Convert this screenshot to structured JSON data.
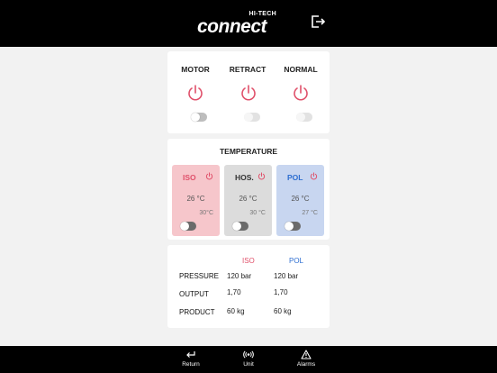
{
  "brand": {
    "tagline": "HI-TECH",
    "name": "connect"
  },
  "controls": [
    {
      "label": "MOTOR",
      "icon": "power-icon",
      "toggle_on": false
    },
    {
      "label": "RETRACT",
      "icon": "power-icon",
      "toggle_on": false
    },
    {
      "label": "NORMAL",
      "icon": "power-icon",
      "toggle_on": false
    }
  ],
  "temperature": {
    "title": "TEMPERATURE",
    "zones": [
      {
        "name": "ISO",
        "current": "26 °C",
        "setpoint": "30°C",
        "toggle_on": false
      },
      {
        "name": "HOS.",
        "current": "26 °C",
        "setpoint": "30 °C",
        "toggle_on": false
      },
      {
        "name": "POL",
        "current": "26 °C",
        "setpoint": "27 °C",
        "toggle_on": false
      }
    ]
  },
  "readings": {
    "columns": [
      "ISO",
      "POL"
    ],
    "rows": [
      {
        "label": "PRESSURE",
        "iso": "120 bar",
        "pol": "120 bar"
      },
      {
        "label": "OUTPUT",
        "iso": "1,70",
        "pol": "1,70"
      },
      {
        "label": "PRODUCT",
        "iso": "60 kg",
        "pol": "60 kg"
      }
    ]
  },
  "nav": [
    {
      "label": "Return",
      "icon": "return-icon"
    },
    {
      "label": "Unit",
      "icon": "unit-signal-icon"
    },
    {
      "label": "Alarms",
      "icon": "alarm-warning-icon"
    }
  ],
  "colors": {
    "iso": "#e0506a",
    "pol": "#2f6fd1",
    "hos": "#333333",
    "power_red": "#e0506a"
  }
}
